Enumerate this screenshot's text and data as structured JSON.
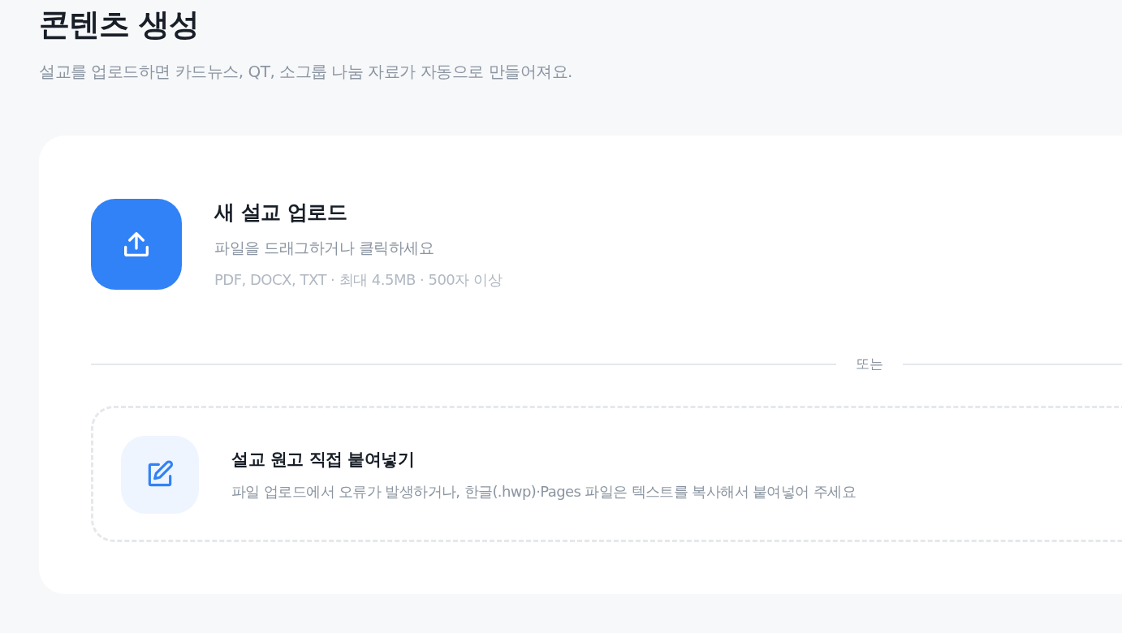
{
  "header": {
    "title": "콘텐츠 생성",
    "subtitle": "설교를 업로드하면 카드뉴스, QT, 소그룹 나눔 자료가 자동으로 만들어져요."
  },
  "upload": {
    "title": "새 설교 업로드",
    "hint": "파일을 드래그하거나 클릭하세요",
    "formats": "PDF, DOCX, TXT · 최대 4.5MB · 500자 이상"
  },
  "divider": {
    "label": "또는"
  },
  "paste": {
    "title": "설교 원고 직접 붙여넣기",
    "description": "파일 업로드에서 오류가 발생하거나, 한글(.hwp)·Pages 파일은 텍스트를 복사해서 붙여넣어 주세요"
  }
}
